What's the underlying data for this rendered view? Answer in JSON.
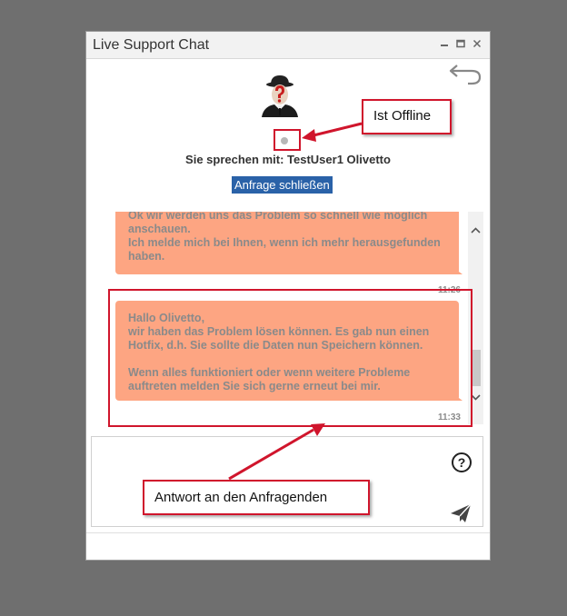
{
  "window": {
    "title": "Live Support Chat"
  },
  "icons": {
    "minimize": "minimize-icon",
    "maximize": "maximize-icon",
    "close": "close-icon",
    "back": "back-arrow-icon",
    "help": "help-icon",
    "send": "send-icon"
  },
  "header": {
    "speaking_with": "Sie sprechen mit: TestUser1 Olivetto",
    "close_request": "Anfrage schließen",
    "status": "offline"
  },
  "messages": [
    {
      "text": "Ok wir werden uns das Problem so schnell wie möglich anschauen.\nIch melde mich bei Ihnen, wenn ich mehr herausgefunden haben.",
      "time": "11:26"
    },
    {
      "text": "Hallo Olivetto,\nwir haben das Problem lösen können. Es gab nun einen Hotfix, d.h. Sie sollte die Daten nun Speichern können.\n\nWenn alles funktioniert oder wenn weitere Probleme auftreten melden Sie sich gerne erneut bei mir.",
      "time": "11:33"
    }
  ],
  "composer": {
    "placeholder": "",
    "help_label": "?"
  },
  "annotations": {
    "offline": "Ist Offline",
    "reply": "Antwort an den Anfragenden"
  },
  "colors": {
    "background": "#6f6f6f",
    "bubble": "#fda582",
    "button": "#2a62a8",
    "annotation": "#d0152c"
  }
}
